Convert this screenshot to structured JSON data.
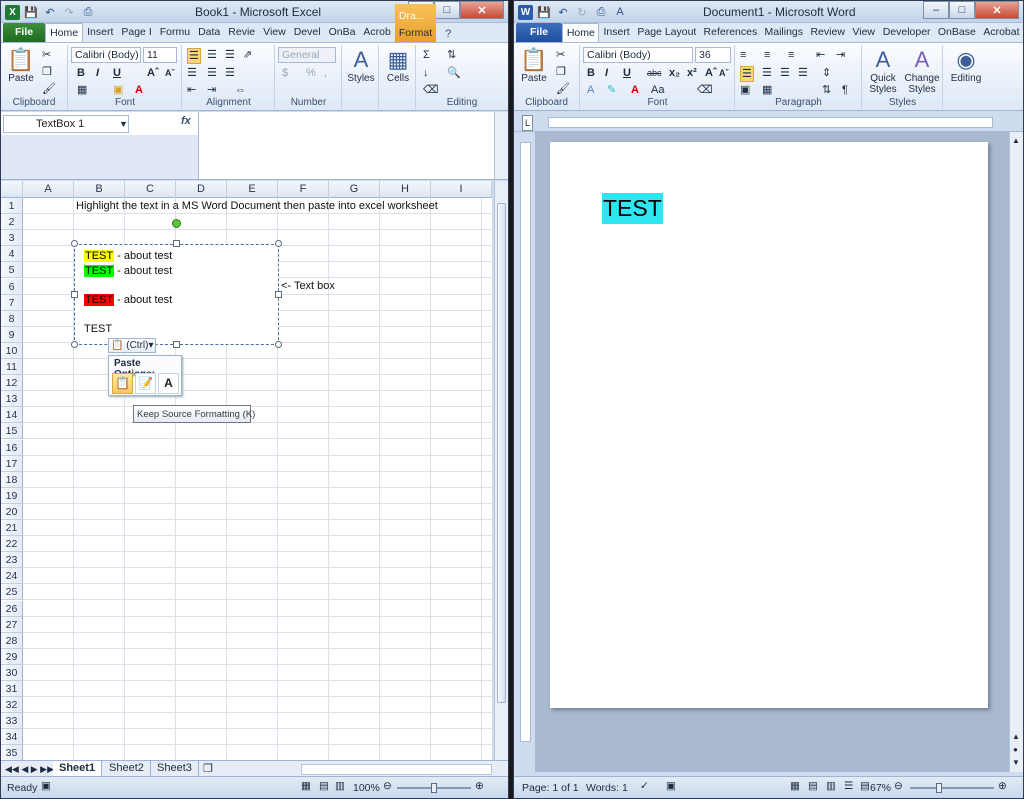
{
  "excel": {
    "title": "Book1  -  Microsoft Excel",
    "context_tab": "Dra...",
    "tabs": [
      "File",
      "Home",
      "Insert",
      "Page I",
      "Formu",
      "Data",
      "Revie",
      "View",
      "Devel",
      "OnBa",
      "Acrob",
      "Format"
    ],
    "ribbon": {
      "paste_label": "Paste",
      "font_name": "Calibri (Body)",
      "font_size": "11",
      "number_format": "General",
      "styles_label": "Styles",
      "cells_label": "Cells",
      "groups": [
        "Clipboard",
        "Font",
        "Alignment",
        "Number",
        "Editing"
      ]
    },
    "name_box": "TextBox 1",
    "fx_label": "fx",
    "columns": [
      "A",
      "B",
      "C",
      "D",
      "E",
      "F",
      "G",
      "H",
      "I"
    ],
    "rows": [
      "1",
      "2",
      "3",
      "4",
      "5",
      "6",
      "7",
      "8",
      "9",
      "10",
      "11",
      "12",
      "13",
      "14",
      "15",
      "16",
      "17",
      "18",
      "19",
      "20",
      "21",
      "22",
      "23",
      "24",
      "25",
      "26",
      "27",
      "28",
      "29",
      "30",
      "31",
      "32",
      "33",
      "34",
      "35"
    ],
    "cell_b1": "Highlight the text in a MS Word Document then paste into excel worksheet",
    "textbox_annotation": "<- Text box",
    "textbox": {
      "line1_hl": "TEST",
      "line1_rest": " - about test",
      "line2_hl": "TEST",
      "line2_rest": " - about test",
      "line3_hl": "TEST",
      "line3_rest": " - about test",
      "line4": "TEST"
    },
    "highlight_colors": {
      "yellow": "#ffff00",
      "green": "#00ff00",
      "red": "#ff0000"
    },
    "paste_ctrl": "(Ctrl)",
    "paste_options_title": "Paste Options:",
    "tooltip": "Keep Source Formatting (K)",
    "sheet_tabs": [
      "Sheet1",
      "Sheet2",
      "Sheet3"
    ],
    "status_ready": "Ready",
    "zoom": "100%"
  },
  "word": {
    "title": "Document1  -  Microsoft Word",
    "tabs": [
      "File",
      "Home",
      "Insert",
      "Page Layout",
      "References",
      "Mailings",
      "Review",
      "View",
      "Developer",
      "OnBase",
      "Acrobat"
    ],
    "ribbon": {
      "paste_label": "Paste",
      "font_name": "Calibri (Body)",
      "font_size": "36",
      "quick_styles_label": "Quick Styles",
      "change_styles_label": "Change Styles",
      "editing_label": "Editing",
      "groups": [
        "Clipboard",
        "Font",
        "Paragraph",
        "Styles"
      ]
    },
    "doc_text": "TEST",
    "doc_highlight": "#2ee6f0",
    "status_page": "Page: 1 of 1",
    "status_words": "Words: 1",
    "zoom": "67%"
  }
}
